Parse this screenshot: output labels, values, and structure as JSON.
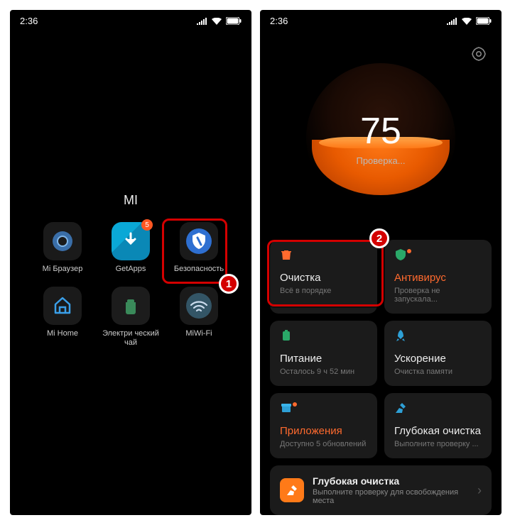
{
  "status": {
    "time": "2:36"
  },
  "left": {
    "folder_title": "MI",
    "apps": {
      "browser": "Mi Браузер",
      "getapps": "GetApps",
      "getapps_badge": "5",
      "security": "Безопасность",
      "mihome": "Mi Home",
      "kettle": "Электри ческий чай",
      "miwifi": "MiWi-Fi"
    },
    "callout": "1"
  },
  "right": {
    "score": "75",
    "score_sub": "Проверка...",
    "cards": {
      "cleanup_title": "Очистка",
      "cleanup_sub": "Всё в порядке",
      "antivirus_title": "Антивирус",
      "antivirus_sub": "Проверка не запускала...",
      "battery_title": "Питание",
      "battery_sub": "Осталось 9 ч 52 мин",
      "boost_title": "Ускорение",
      "boost_sub": "Очистка памяти",
      "apps_title": "Приложения",
      "apps_sub": "Доступно 5 обновлений",
      "deep_title": "Глубокая очистка",
      "deep_sub": "Выполните проверку ...",
      "promo_title": "Глубокая очистка",
      "promo_sub": "Выполните проверку для освобождения места"
    },
    "callout": "2"
  }
}
